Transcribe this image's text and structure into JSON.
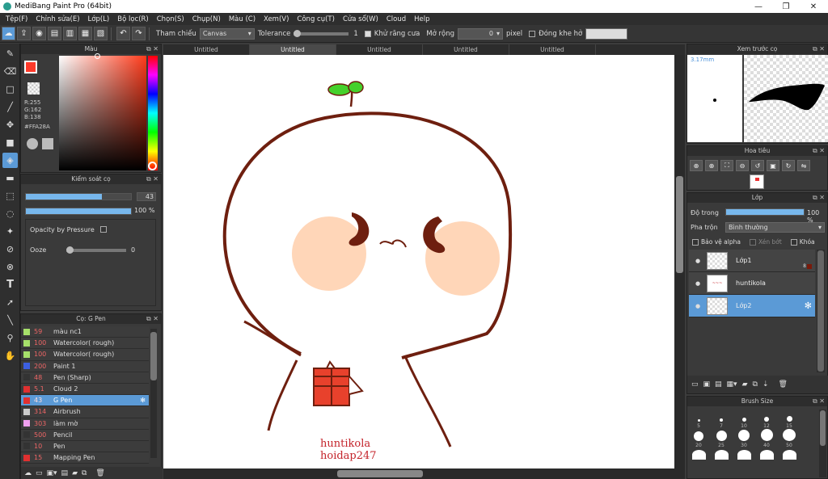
{
  "window": {
    "title": "MediBang Paint Pro (64bit)",
    "minimize": "—",
    "maximize": "❐",
    "close": "✕"
  },
  "menu": [
    "Tệp(F)",
    "Chỉnh sửa(E)",
    "Lớp(L)",
    "Bộ lọc(R)",
    "Chọn(S)",
    "Chụp(N)",
    "Màu (C)",
    "Xem(V)",
    "Công cụ(T)",
    "Cửa sổ(W)",
    "Cloud",
    "Help"
  ],
  "toolbar": {
    "reference_label": "Tham chiếu",
    "reference_value": "Canvas",
    "tolerance_label": "Tolerance",
    "tolerance_value": "1",
    "antialias_label": "Khử răng cưa",
    "expand_label": "Mở rộng",
    "expand_value": "0",
    "expand_unit": "pixel",
    "close_gap_label": "Đóng khe hở"
  },
  "color_panel": {
    "title": "Màu",
    "r": "R:255",
    "g": "G:162",
    "b": "B:138",
    "hex": "#FFA28A",
    "primary_color": "#ff3a2a"
  },
  "brush_control": {
    "title": "Kiểm soát cọ",
    "size": "43",
    "size_fraction": 0.72,
    "opacity": "100 %",
    "opacity_fraction": 1.0,
    "opacity_pressure_label": "Opacity by Pressure",
    "ooze_label": "Ooze",
    "ooze_value": "0"
  },
  "brush_list": {
    "title": "Cọ: G Pen",
    "items": [
      {
        "size": "59",
        "name": "màu nc1",
        "color": "#a6e06a",
        "active": false
      },
      {
        "size": "100",
        "name": "Watercolor( rough)",
        "color": "#a6e06a",
        "active": false
      },
      {
        "size": "100",
        "name": "Watercolor( rough)",
        "color": "#a6e06a",
        "active": false
      },
      {
        "size": "200",
        "name": "Paint 1",
        "color": "#3c5fe0",
        "active": false
      },
      {
        "size": "48",
        "name": "Pen (Sharp)",
        "color": "#333333",
        "active": false
      },
      {
        "size": "5.1",
        "name": "Cloud 2",
        "color": "#e03030",
        "active": false
      },
      {
        "size": "43",
        "name": "G Pen",
        "color": "#e03030",
        "active": true
      },
      {
        "size": "314",
        "name": "Airbrush",
        "color": "#cccccc",
        "active": false
      },
      {
        "size": "303",
        "name": "làm mờ",
        "color": "#f0a0f0",
        "active": false
      },
      {
        "size": "500",
        "name": "Pencil",
        "color": "#333333",
        "active": false
      },
      {
        "size": "10",
        "name": "Pen",
        "color": "#333333",
        "active": false
      },
      {
        "size": "15",
        "name": "Mapping Pen",
        "color": "#e03030",
        "active": false
      }
    ]
  },
  "tabs": [
    "Untitled",
    "Untitled",
    "Untitled",
    "Untitled",
    "Untitled"
  ],
  "active_tab": 1,
  "canvas": {
    "signature_line1": "huntikola",
    "signature_line2": "hoidap247"
  },
  "preview": {
    "title": "Xem trước cọ",
    "size_label": "3.17mm"
  },
  "navigator": {
    "title": "Hoa tiêu"
  },
  "layers": {
    "title": "Lớp",
    "opacity_label": "Độ trong",
    "opacity_value": "100 %",
    "blend_label": "Pha trộn",
    "blend_value": "Bình thường",
    "protect_alpha": "Bảo vệ alpha",
    "clipping": "Xén bớt",
    "lock": "Khóa",
    "items": [
      {
        "name": "Lớp1",
        "badge": "8",
        "active": false
      },
      {
        "name": "huntikola",
        "badge": "",
        "active": false
      },
      {
        "name": "Lớp2",
        "badge": "",
        "active": true
      }
    ]
  },
  "brush_size": {
    "title": "Brush Size",
    "sizes": [
      "5",
      "7",
      "10",
      "12",
      "15",
      "20",
      "25",
      "30",
      "40",
      "50"
    ]
  },
  "colors": {
    "accent": "#5b9ad6",
    "bar": "#77b7ec",
    "line": "#6e1f0f",
    "cheek": "#ffd6b8",
    "sprout": "#45d12c"
  }
}
